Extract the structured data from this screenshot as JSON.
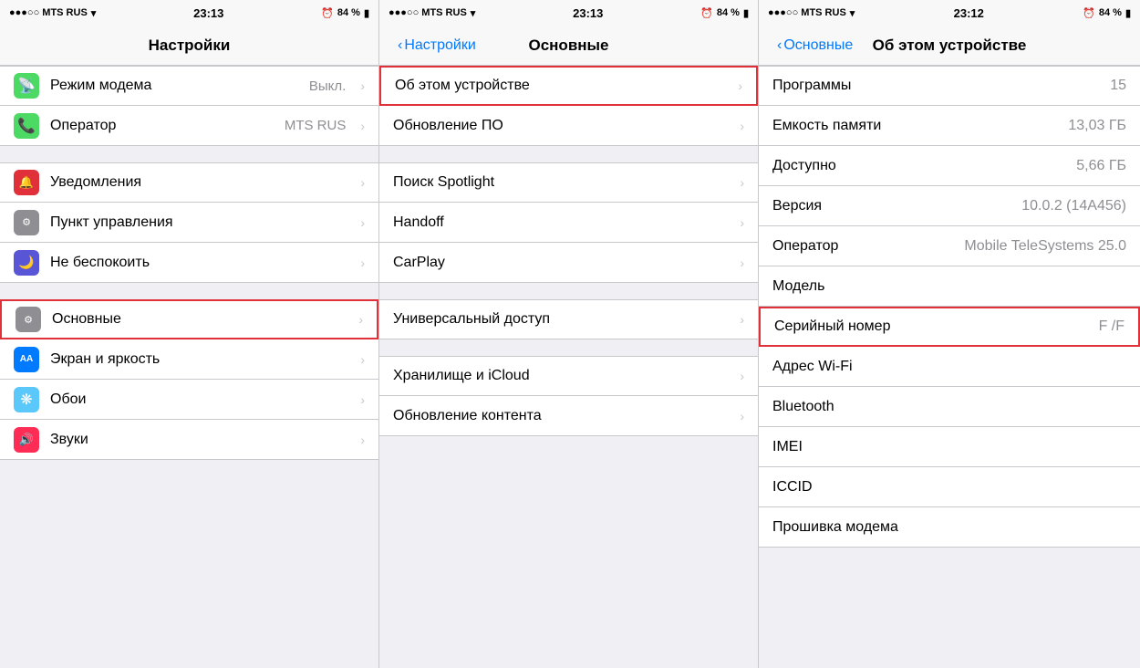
{
  "panel1": {
    "statusBar": {
      "carrier": "●●●○○ MTS RUS",
      "signal": "▼",
      "time": "23:13",
      "alarm": "⏰",
      "battery": "84 %",
      "batteryIcon": "🔋"
    },
    "title": "Настройки",
    "items": [
      {
        "id": "modem",
        "icon": "📡",
        "iconBg": "icon-green",
        "label": "Режим модема",
        "value": "Выкл.",
        "chevron": true
      },
      {
        "id": "operator",
        "icon": "📞",
        "iconBg": "icon-green",
        "label": "Оператор",
        "value": "MTS RUS",
        "chevron": true
      },
      {
        "id": "notifications",
        "icon": "🔔",
        "iconBg": "icon-red",
        "label": "Уведомления",
        "value": "",
        "chevron": true
      },
      {
        "id": "control-center",
        "icon": "⚙",
        "iconBg": "icon-gray",
        "label": "Пункт управления",
        "value": "",
        "chevron": true
      },
      {
        "id": "dnd",
        "icon": "🌙",
        "iconBg": "icon-purple",
        "label": "Не беспокоить",
        "value": "",
        "chevron": true
      },
      {
        "id": "general",
        "icon": "⚙",
        "iconBg": "icon-gray",
        "label": "Основные",
        "value": "",
        "chevron": true,
        "highlighted": true
      },
      {
        "id": "display",
        "icon": "AA",
        "iconBg": "icon-blue",
        "label": "Экран и яркость",
        "value": "",
        "chevron": true
      },
      {
        "id": "wallpaper",
        "icon": "❋",
        "iconBg": "icon-teal",
        "label": "Обои",
        "value": "",
        "chevron": true
      },
      {
        "id": "sounds",
        "icon": "🔊",
        "iconBg": "icon-pink",
        "label": "Звуки",
        "value": "",
        "chevron": true
      }
    ]
  },
  "panel2": {
    "statusBar": {
      "carrier": "●●●○○ MTS RUS",
      "time": "23:13",
      "battery": "84 %"
    },
    "backLabel": "Настройки",
    "title": "Основные",
    "items": [
      {
        "id": "about",
        "label": "Об этом устройстве",
        "chevron": true,
        "highlighted": true
      },
      {
        "id": "update",
        "label": "Обновление ПО",
        "chevron": true
      },
      {
        "id": "spotlight",
        "label": "Поиск Spotlight",
        "chevron": true
      },
      {
        "id": "handoff",
        "label": "Handoff",
        "chevron": true
      },
      {
        "id": "carplay",
        "label": "CarPlay",
        "chevron": true
      },
      {
        "id": "accessibility",
        "label": "Универсальный доступ",
        "chevron": true
      },
      {
        "id": "icloud-storage",
        "label": "Хранилище и iCloud",
        "chevron": true
      },
      {
        "id": "content-update",
        "label": "Обновление контента",
        "chevron": true
      }
    ]
  },
  "panel3": {
    "statusBar": {
      "carrier": "●●●○○ MTS RUS",
      "time": "23:12",
      "battery": "84 %"
    },
    "backLabel": "Основные",
    "title": "Об этом устройстве",
    "items": [
      {
        "id": "programs",
        "label": "Программы",
        "value": "15"
      },
      {
        "id": "capacity",
        "label": "Емкость памяти",
        "value": "13,03 ГБ"
      },
      {
        "id": "available",
        "label": "Доступно",
        "value": "5,66 ГБ"
      },
      {
        "id": "version",
        "label": "Версия",
        "value": "10.0.2 (14A456)"
      },
      {
        "id": "operator",
        "label": "Оператор",
        "value": "Mobile TeleSystems 25.0"
      },
      {
        "id": "model",
        "label": "Модель",
        "value": ""
      },
      {
        "id": "serial",
        "label": "Серийный номер",
        "value": "F                    /F",
        "highlighted": true
      },
      {
        "id": "wifi",
        "label": "Адрес Wi-Fi",
        "value": ""
      },
      {
        "id": "bluetooth",
        "label": "Bluetooth",
        "value": ""
      },
      {
        "id": "imei",
        "label": "IMEI",
        "value": ""
      },
      {
        "id": "iccid",
        "label": "ICCID",
        "value": ""
      },
      {
        "id": "modem",
        "label": "Прошивка модема",
        "value": ""
      }
    ]
  }
}
